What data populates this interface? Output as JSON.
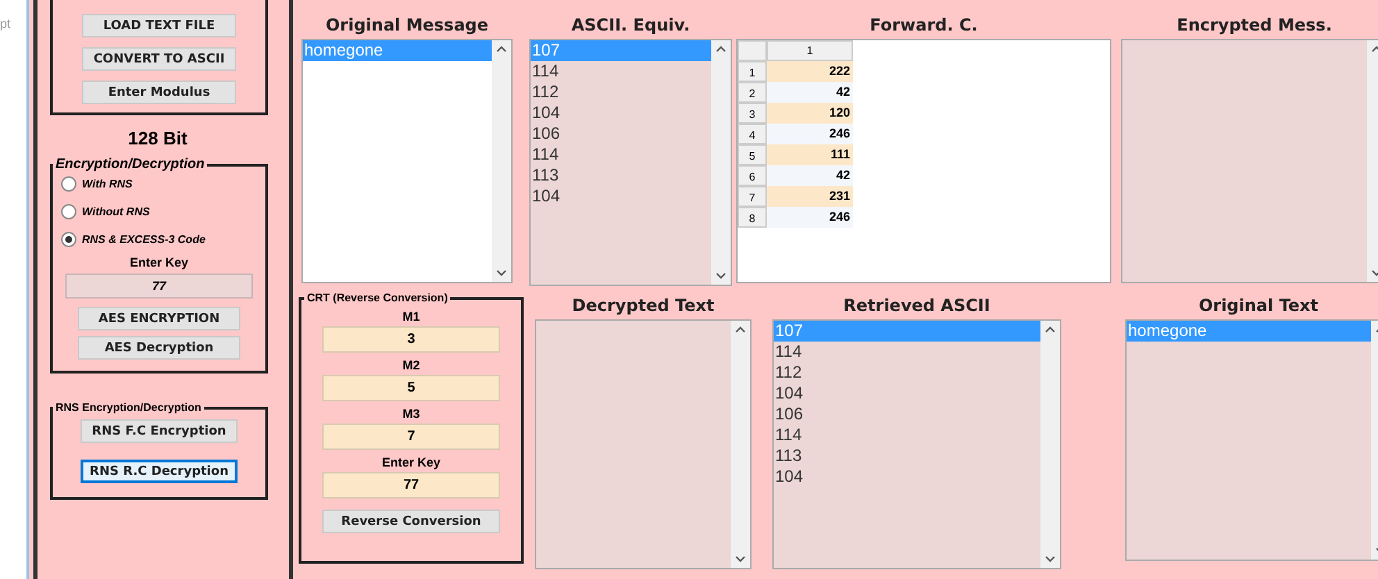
{
  "edge_text": "pt",
  "left_panel": {
    "file_buttons": [
      "LOAD TEXT FILE",
      "CONVERT TO ASCII",
      "Enter Modulus"
    ],
    "bit_label": "128 Bit",
    "encryption_group": {
      "title": "Encryption/Decryption",
      "options": [
        {
          "label": "With RNS",
          "selected": false
        },
        {
          "label": "Without RNS",
          "selected": false
        },
        {
          "label": "RNS & EXCESS-3 Code",
          "selected": true
        }
      ],
      "key_label": "Enter Key",
      "key_value": "77",
      "buttons": [
        "AES ENCRYPTION",
        "AES Decryption"
      ]
    },
    "rns_group": {
      "title": "RNS Encryption/Decryption",
      "buttons": [
        {
          "label": "RNS F.C Encryption",
          "focused": false
        },
        {
          "label": "RNS R.C Decryption",
          "focused": true
        }
      ]
    }
  },
  "original_message": {
    "title": "Original Message",
    "items": [
      {
        "text": "homegone",
        "selected": true
      }
    ]
  },
  "ascii_equiv": {
    "title": "ASCII. Equiv.",
    "items": [
      {
        "text": "107",
        "selected": true
      },
      {
        "text": "114",
        "selected": false
      },
      {
        "text": "112",
        "selected": false
      },
      {
        "text": "104",
        "selected": false
      },
      {
        "text": "106",
        "selected": false
      },
      {
        "text": "114",
        "selected": false
      },
      {
        "text": "113",
        "selected": false
      },
      {
        "text": "104",
        "selected": false
      }
    ]
  },
  "forward_c": {
    "title": "Forward. C.",
    "column": "1",
    "rows": [
      {
        "index": "1",
        "value": "222"
      },
      {
        "index": "2",
        "value": "42"
      },
      {
        "index": "3",
        "value": "120"
      },
      {
        "index": "4",
        "value": "246"
      },
      {
        "index": "5",
        "value": "111"
      },
      {
        "index": "6",
        "value": "42"
      },
      {
        "index": "7",
        "value": "231"
      },
      {
        "index": "8",
        "value": "246"
      }
    ]
  },
  "encrypted_message": {
    "title": "Encrypted Mess."
  },
  "crt": {
    "title": "CRT (Reverse Conversion)",
    "fields": [
      {
        "label": "M1",
        "value": "3"
      },
      {
        "label": "M2",
        "value": "5"
      },
      {
        "label": "M3",
        "value": "7"
      },
      {
        "label": "Enter Key",
        "value": "77"
      }
    ],
    "button": "Reverse Conversion"
  },
  "decrypted_text": {
    "title": "Decrypted Text"
  },
  "retrieved_ascii": {
    "title": "Retrieved ASCII",
    "items": [
      {
        "text": "107",
        "selected": true
      },
      {
        "text": "114",
        "selected": false
      },
      {
        "text": "112",
        "selected": false
      },
      {
        "text": "104",
        "selected": false
      },
      {
        "text": "106",
        "selected": false
      },
      {
        "text": "114",
        "selected": false
      },
      {
        "text": "113",
        "selected": false
      },
      {
        "text": "104",
        "selected": false
      }
    ]
  },
  "original_text": {
    "title": "Original Text",
    "items": [
      {
        "text": "homegone",
        "selected": true
      }
    ]
  }
}
